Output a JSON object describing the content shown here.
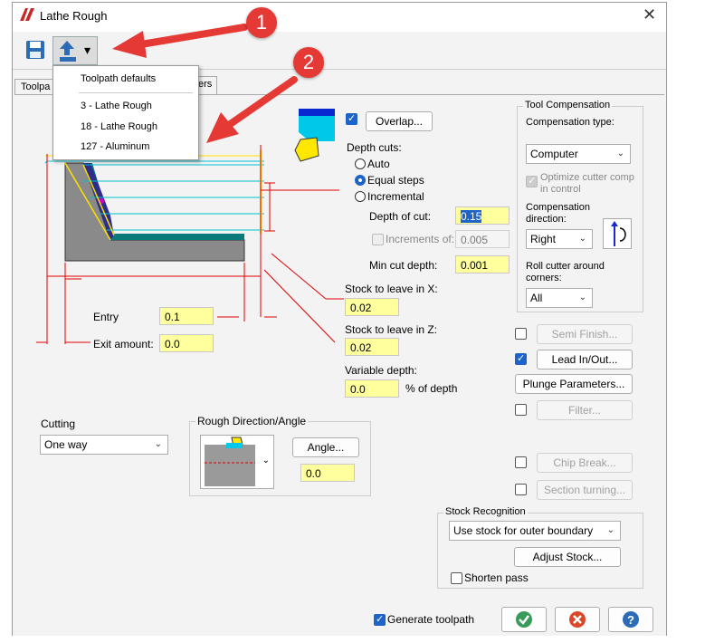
{
  "window": {
    "title": "Lathe Rough",
    "close_glyph": "✕"
  },
  "toolbar": {
    "save_icon": "save-icon",
    "load_icon": "load-defaults-icon",
    "dropdown_glyph": "▾"
  },
  "menu": {
    "header": "Toolpath defaults",
    "items": [
      "3 - Lathe Rough",
      "18 - Lathe Rough",
      "127 - Aluminum"
    ]
  },
  "tabs": {
    "first_partial": "Toolpa",
    "second_partial": "ers"
  },
  "callouts": [
    "1",
    "2"
  ],
  "overlap_label": "Overlap...",
  "depth_cuts": {
    "label": "Depth cuts:",
    "options": [
      "Auto",
      "Equal steps",
      "Incremental"
    ],
    "selected": "Equal steps"
  },
  "depth_of_cut": {
    "label": "Depth of cut:",
    "value": "0.15"
  },
  "increments_of": {
    "label": "Increments of:",
    "value": "0.005"
  },
  "min_cut_depth": {
    "label": "Min cut depth:",
    "value": "0.001"
  },
  "stock_x": {
    "label": "Stock to leave in X:",
    "value": "0.02"
  },
  "stock_z": {
    "label": "Stock to leave in Z:",
    "value": "0.02"
  },
  "variable_depth": {
    "label": "Variable depth:",
    "value": "0.0",
    "suffix": "% of depth"
  },
  "entry": {
    "label": "Entry",
    "value": "0.1"
  },
  "exit_amount": {
    "label": "Exit amount:",
    "value": "0.0"
  },
  "cutting": {
    "label": "Cutting",
    "value": "One way"
  },
  "rough_direction": {
    "title": "Rough Direction/Angle",
    "angle_button": "Angle...",
    "angle_value": "0.0"
  },
  "tool_comp": {
    "title": "Tool Compensation",
    "type_label": "Compensation type:",
    "type_value": "Computer",
    "optimize_label_1": "Optimize cutter comp",
    "optimize_label_2": "in control",
    "direction_label_1": "Compensation",
    "direction_label_2": "direction:",
    "direction_value": "Right",
    "roll_label_1": "Roll cutter around",
    "roll_label_2": "corners:",
    "roll_value": "All"
  },
  "right_buttons": {
    "semi_finish": "Semi Finish...",
    "lead_in_out": "Lead In/Out...",
    "plunge": "Plunge Parameters...",
    "filter": "Filter...",
    "chip_break": "Chip Break...",
    "section_turning": "Section turning..."
  },
  "stock_recognition": {
    "title": "Stock Recognition",
    "value": "Use stock for outer boundary",
    "adjust_button": "Adjust Stock...",
    "shorten_label": "Shorten pass"
  },
  "generate_toolpath": "Generate toolpath",
  "colors": {
    "accent": "#1e63c7",
    "field_yellow": "#ffff9e",
    "callout_red": "#e53935"
  }
}
